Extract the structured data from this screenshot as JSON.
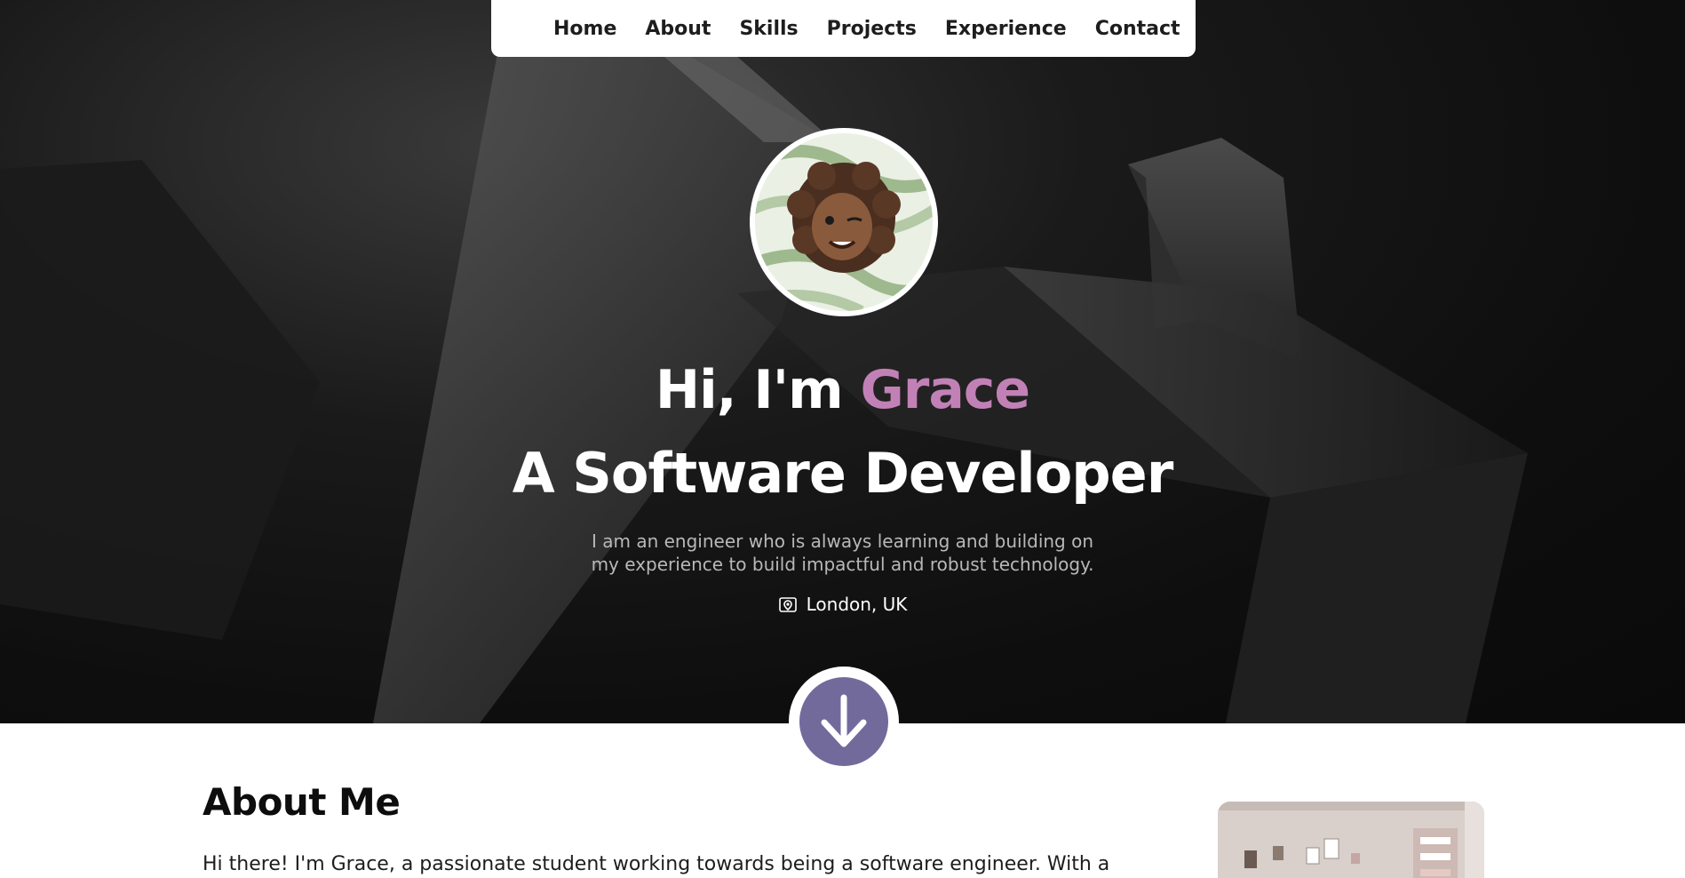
{
  "nav": {
    "logo_icon": "g-letter-logo-icon",
    "items": [
      {
        "label": "Home"
      },
      {
        "label": "About"
      },
      {
        "label": "Skills"
      },
      {
        "label": "Projects"
      },
      {
        "label": "Experience"
      },
      {
        "label": "Contact"
      }
    ]
  },
  "hero": {
    "greeting_prefix": "Hi, I'm ",
    "name": "Grace",
    "subtitle": "A Software Developer",
    "description": "I am an engineer who is always learning and building on my experience to build impactful and robust technology.",
    "location": "London, UK",
    "location_icon": "map-pin-icon",
    "scroll_icon": "arrow-down-icon"
  },
  "about": {
    "title": "About Me",
    "text": "Hi there! I'm Grace, a passionate student working towards being a software engineer. With a"
  },
  "colors": {
    "accent": "#c281b6",
    "button": "#736a9c",
    "hero_bg": "#0e0e0e"
  }
}
